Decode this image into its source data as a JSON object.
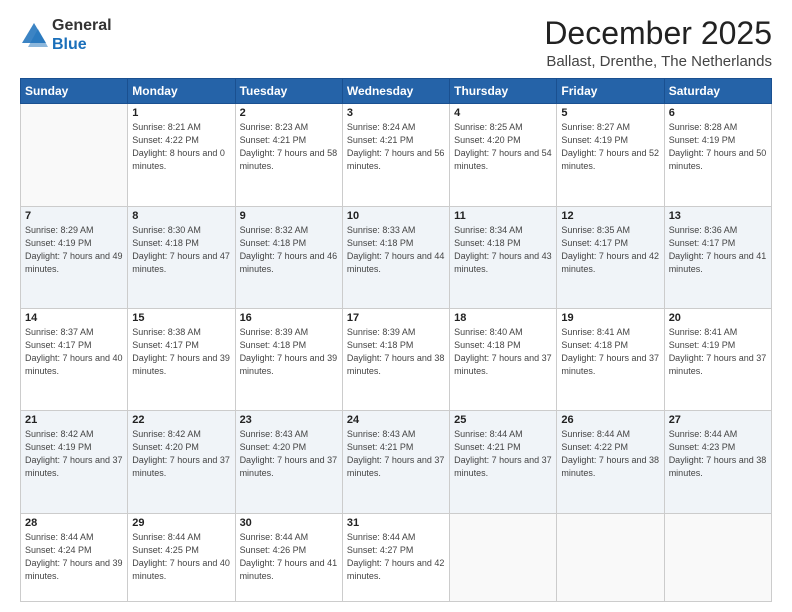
{
  "header": {
    "logo": {
      "line1": "General",
      "line2": "Blue"
    },
    "title": "December 2025",
    "location": "Ballast, Drenthe, The Netherlands"
  },
  "weekdays": [
    "Sunday",
    "Monday",
    "Tuesday",
    "Wednesday",
    "Thursday",
    "Friday",
    "Saturday"
  ],
  "weeks": [
    [
      {
        "day": "",
        "sunrise": "",
        "sunset": "",
        "daylight": ""
      },
      {
        "day": "1",
        "sunrise": "Sunrise: 8:21 AM",
        "sunset": "Sunset: 4:22 PM",
        "daylight": "Daylight: 8 hours and 0 minutes."
      },
      {
        "day": "2",
        "sunrise": "Sunrise: 8:23 AM",
        "sunset": "Sunset: 4:21 PM",
        "daylight": "Daylight: 7 hours and 58 minutes."
      },
      {
        "day": "3",
        "sunrise": "Sunrise: 8:24 AM",
        "sunset": "Sunset: 4:21 PM",
        "daylight": "Daylight: 7 hours and 56 minutes."
      },
      {
        "day": "4",
        "sunrise": "Sunrise: 8:25 AM",
        "sunset": "Sunset: 4:20 PM",
        "daylight": "Daylight: 7 hours and 54 minutes."
      },
      {
        "day": "5",
        "sunrise": "Sunrise: 8:27 AM",
        "sunset": "Sunset: 4:19 PM",
        "daylight": "Daylight: 7 hours and 52 minutes."
      },
      {
        "day": "6",
        "sunrise": "Sunrise: 8:28 AM",
        "sunset": "Sunset: 4:19 PM",
        "daylight": "Daylight: 7 hours and 50 minutes."
      }
    ],
    [
      {
        "day": "7",
        "sunrise": "Sunrise: 8:29 AM",
        "sunset": "Sunset: 4:19 PM",
        "daylight": "Daylight: 7 hours and 49 minutes."
      },
      {
        "day": "8",
        "sunrise": "Sunrise: 8:30 AM",
        "sunset": "Sunset: 4:18 PM",
        "daylight": "Daylight: 7 hours and 47 minutes."
      },
      {
        "day": "9",
        "sunrise": "Sunrise: 8:32 AM",
        "sunset": "Sunset: 4:18 PM",
        "daylight": "Daylight: 7 hours and 46 minutes."
      },
      {
        "day": "10",
        "sunrise": "Sunrise: 8:33 AM",
        "sunset": "Sunset: 4:18 PM",
        "daylight": "Daylight: 7 hours and 44 minutes."
      },
      {
        "day": "11",
        "sunrise": "Sunrise: 8:34 AM",
        "sunset": "Sunset: 4:18 PM",
        "daylight": "Daylight: 7 hours and 43 minutes."
      },
      {
        "day": "12",
        "sunrise": "Sunrise: 8:35 AM",
        "sunset": "Sunset: 4:17 PM",
        "daylight": "Daylight: 7 hours and 42 minutes."
      },
      {
        "day": "13",
        "sunrise": "Sunrise: 8:36 AM",
        "sunset": "Sunset: 4:17 PM",
        "daylight": "Daylight: 7 hours and 41 minutes."
      }
    ],
    [
      {
        "day": "14",
        "sunrise": "Sunrise: 8:37 AM",
        "sunset": "Sunset: 4:17 PM",
        "daylight": "Daylight: 7 hours and 40 minutes."
      },
      {
        "day": "15",
        "sunrise": "Sunrise: 8:38 AM",
        "sunset": "Sunset: 4:17 PM",
        "daylight": "Daylight: 7 hours and 39 minutes."
      },
      {
        "day": "16",
        "sunrise": "Sunrise: 8:39 AM",
        "sunset": "Sunset: 4:18 PM",
        "daylight": "Daylight: 7 hours and 39 minutes."
      },
      {
        "day": "17",
        "sunrise": "Sunrise: 8:39 AM",
        "sunset": "Sunset: 4:18 PM",
        "daylight": "Daylight: 7 hours and 38 minutes."
      },
      {
        "day": "18",
        "sunrise": "Sunrise: 8:40 AM",
        "sunset": "Sunset: 4:18 PM",
        "daylight": "Daylight: 7 hours and 37 minutes."
      },
      {
        "day": "19",
        "sunrise": "Sunrise: 8:41 AM",
        "sunset": "Sunset: 4:18 PM",
        "daylight": "Daylight: 7 hours and 37 minutes."
      },
      {
        "day": "20",
        "sunrise": "Sunrise: 8:41 AM",
        "sunset": "Sunset: 4:19 PM",
        "daylight": "Daylight: 7 hours and 37 minutes."
      }
    ],
    [
      {
        "day": "21",
        "sunrise": "Sunrise: 8:42 AM",
        "sunset": "Sunset: 4:19 PM",
        "daylight": "Daylight: 7 hours and 37 minutes."
      },
      {
        "day": "22",
        "sunrise": "Sunrise: 8:42 AM",
        "sunset": "Sunset: 4:20 PM",
        "daylight": "Daylight: 7 hours and 37 minutes."
      },
      {
        "day": "23",
        "sunrise": "Sunrise: 8:43 AM",
        "sunset": "Sunset: 4:20 PM",
        "daylight": "Daylight: 7 hours and 37 minutes."
      },
      {
        "day": "24",
        "sunrise": "Sunrise: 8:43 AM",
        "sunset": "Sunset: 4:21 PM",
        "daylight": "Daylight: 7 hours and 37 minutes."
      },
      {
        "day": "25",
        "sunrise": "Sunrise: 8:44 AM",
        "sunset": "Sunset: 4:21 PM",
        "daylight": "Daylight: 7 hours and 37 minutes."
      },
      {
        "day": "26",
        "sunrise": "Sunrise: 8:44 AM",
        "sunset": "Sunset: 4:22 PM",
        "daylight": "Daylight: 7 hours and 38 minutes."
      },
      {
        "day": "27",
        "sunrise": "Sunrise: 8:44 AM",
        "sunset": "Sunset: 4:23 PM",
        "daylight": "Daylight: 7 hours and 38 minutes."
      }
    ],
    [
      {
        "day": "28",
        "sunrise": "Sunrise: 8:44 AM",
        "sunset": "Sunset: 4:24 PM",
        "daylight": "Daylight: 7 hours and 39 minutes."
      },
      {
        "day": "29",
        "sunrise": "Sunrise: 8:44 AM",
        "sunset": "Sunset: 4:25 PM",
        "daylight": "Daylight: 7 hours and 40 minutes."
      },
      {
        "day": "30",
        "sunrise": "Sunrise: 8:44 AM",
        "sunset": "Sunset: 4:26 PM",
        "daylight": "Daylight: 7 hours and 41 minutes."
      },
      {
        "day": "31",
        "sunrise": "Sunrise: 8:44 AM",
        "sunset": "Sunset: 4:27 PM",
        "daylight": "Daylight: 7 hours and 42 minutes."
      },
      {
        "day": "",
        "sunrise": "",
        "sunset": "",
        "daylight": ""
      },
      {
        "day": "",
        "sunrise": "",
        "sunset": "",
        "daylight": ""
      },
      {
        "day": "",
        "sunrise": "",
        "sunset": "",
        "daylight": ""
      }
    ]
  ]
}
